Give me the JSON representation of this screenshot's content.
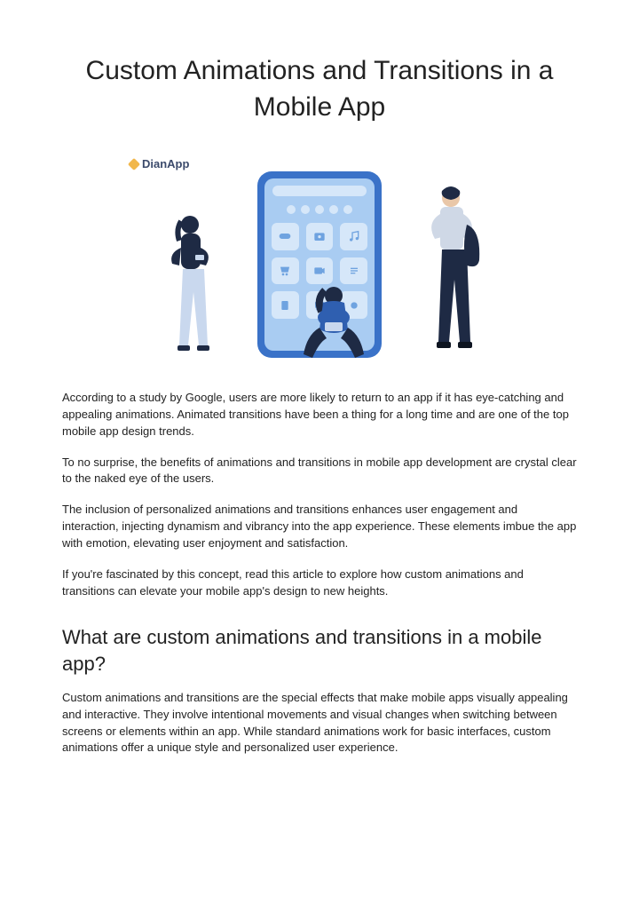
{
  "title": "Custom Animations and Transitions in a Mobile App",
  "brand": "DianApp",
  "paragraphs": {
    "p1": "According to a study by Google, users are more likely to return to an app if it has eye-catching and appealing animations. Animated transitions have been a thing for a long time and are one of the top mobile app design trends.",
    "p2": "To no surprise, the benefits of animations and transitions in mobile app development are crystal clear to the naked eye of the users.",
    "p3": "The inclusion of personalized animations and transitions enhances user engagement and interaction, injecting dynamism and vibrancy into the app experience. These elements imbue the app with emotion, elevating user enjoyment and satisfaction.",
    "p4": "If you're fascinated by this concept, read this article to explore how custom animations and transitions can elevate your mobile app's design to new heights."
  },
  "section_heading": "What are custom animations and transitions in a mobile app?",
  "section_body": "Custom animations and transitions are the special effects that make mobile apps visually appealing and interactive. They involve intentional movements and visual changes when switching between screens or elements within an app. While standard animations work for basic interfaces, custom animations offer a unique style and personalized user experience."
}
